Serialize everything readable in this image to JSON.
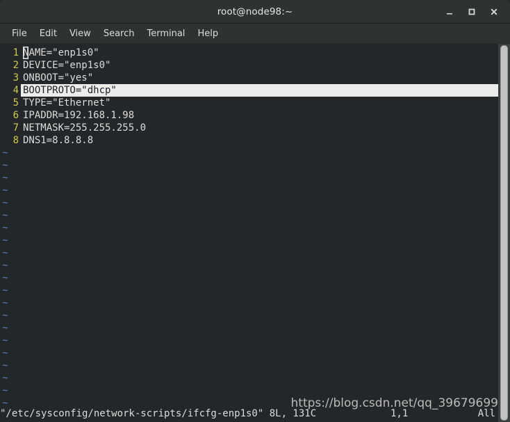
{
  "window": {
    "title": "root@node98:~",
    "controls": [
      {
        "name": "minimize",
        "glyph": "_"
      },
      {
        "name": "maximize",
        "glyph": "□"
      },
      {
        "name": "close",
        "glyph": "✕"
      }
    ]
  },
  "menubar": {
    "items": [
      {
        "label": "File"
      },
      {
        "label": "Edit"
      },
      {
        "label": "View"
      },
      {
        "label": "Search"
      },
      {
        "label": "Terminal"
      },
      {
        "label": "Help"
      }
    ]
  },
  "editor": {
    "app": "vim",
    "cursor_char": "N",
    "cursor_line": 4,
    "lines": [
      {
        "num": "1",
        "text": "NAME=\"enp1s0\""
      },
      {
        "num": "2",
        "text": "DEVICE=\"enp1s0\""
      },
      {
        "num": "3",
        "text": "ONBOOT=\"yes\""
      },
      {
        "num": "4",
        "text": "BOOTPROTO=\"dhcp\""
      },
      {
        "num": "5",
        "text": "TYPE=\"Ethernet\""
      },
      {
        "num": "6",
        "text": "IPADDR=192.168.1.98"
      },
      {
        "num": "7",
        "text": "NETMASK=255.255.255.0"
      },
      {
        "num": "8",
        "text": "DNS1=8.8.8.8"
      }
    ],
    "empty_marker": "~",
    "empty_marker_count": 21
  },
  "statusline": {
    "file_info": "\"/etc/sysconfig/network-scripts/ifcfg-enp1s0\" 8L, 131C",
    "position": "1,1",
    "ruler": "All"
  },
  "watermark": {
    "text": "https://blog.csdn.net/qq_39679699"
  },
  "colors": {
    "titlebar_bg": "#2e3233",
    "terminal_bg": "#232729",
    "text": "#dcdcdc",
    "line_number": "#d4c84a",
    "tilde": "#5b7fbd",
    "cursorline_bg": "#ececeb",
    "scrollbar_thumb": "#c2c2c0"
  }
}
